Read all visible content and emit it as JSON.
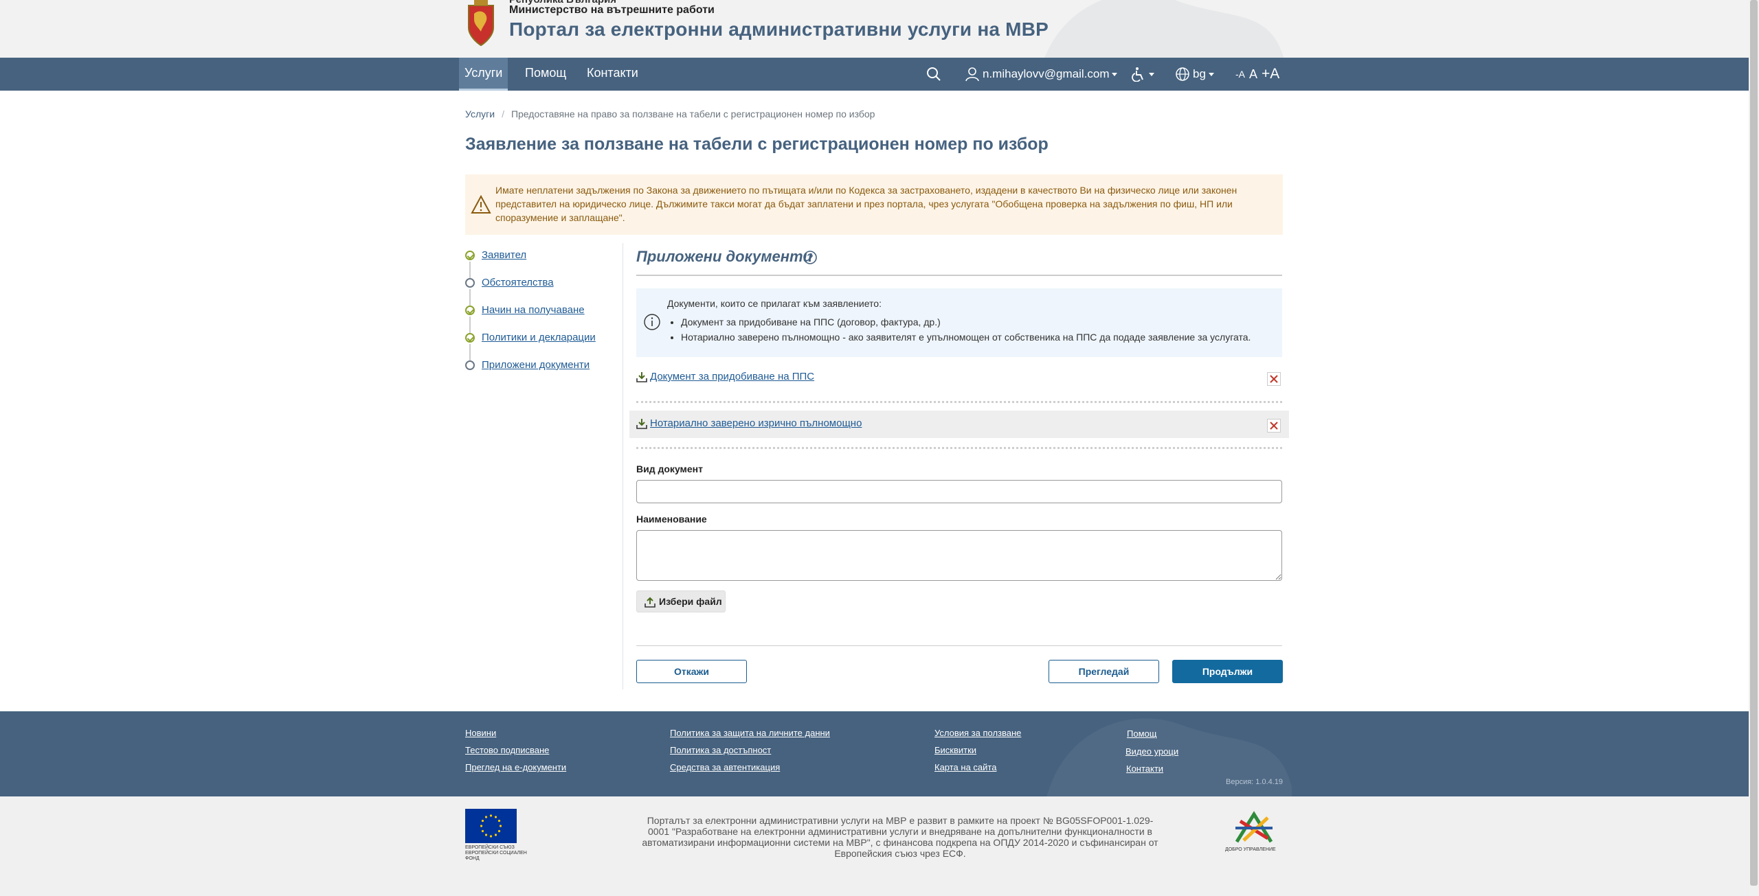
{
  "header": {
    "country": "Република България",
    "ministry": "Министерство на вътрешните работи",
    "portal_title": "Портал за електронни административни услуги на МВР"
  },
  "nav": {
    "items": [
      {
        "label": "Услуги",
        "active": true
      },
      {
        "label": "Помощ"
      },
      {
        "label": "Контакти"
      }
    ],
    "user_email": "n.mihaylovv@gmail.com",
    "language": "bg",
    "font_sizes": [
      "-A",
      "A",
      "+A"
    ]
  },
  "breadcrumb": {
    "home": "Услуги",
    "current": "Предоставяне на право за ползване на табели с регистрационен номер по избор"
  },
  "page_title": "Заявление за ползване на табели с регистрационен номер по избор",
  "alert": {
    "text": "Имате неплатени задължения по Закона за движението по пътищата и/или по Кодекса за застраховането, издадени в качеството Ви на физическо лице или законен представител на юридическо лице. Дължимите такси могат да бъдат заплатени и през портала, чрез услугата \"Обобщена проверка на задължения по фиш, НП или споразумение и заплащане\"."
  },
  "steps": [
    {
      "label": "Заявител",
      "done": true
    },
    {
      "label": "Обстоятелства",
      "done": false
    },
    {
      "label": "Начин на получаване",
      "done": true
    },
    {
      "label": "Политики и декларации",
      "done": true
    },
    {
      "label": "Приложени документи",
      "done": false
    }
  ],
  "section": {
    "title": "Приложени документи"
  },
  "info": {
    "intro": "Документи, които се прилагат към заявлението:",
    "items": [
      "Документ за придобиване на ППС (договор, фактура, др.)",
      "Нотариално заверено пълномощно - ако заявителят е упълномощен от собственика на ППС да подаде заявление за услугата."
    ]
  },
  "documents": [
    {
      "name": "Документ за придобиване на ППС"
    },
    {
      "name": "Нотариално заверено изрично пълномощно"
    }
  ],
  "form": {
    "doc_type_label": "Вид документ",
    "doc_type_value": "",
    "name_label": "Наименование",
    "name_value": "",
    "choose_file": "Избери файл"
  },
  "actions": {
    "cancel": "Откажи",
    "preview": "Прегледай",
    "continue": "Продължи"
  },
  "footer": {
    "col1": [
      "Новини",
      "Тестово подписване",
      "Преглед на е-документи"
    ],
    "col2": [
      "Политика за защита на личните данни",
      "Политика за достъпност",
      "Средства за автентикация"
    ],
    "col3": [
      "Условия за ползване",
      "Бисквитки",
      "Карта на сайта"
    ],
    "col4": [
      "Помощ",
      "Видео уроци",
      "Контакти"
    ],
    "version": "Версия: 1.0.4.19",
    "eu_caption": "ЕВРОПЕЙСКИ СЪЮЗ ЕВРОПЕЙСКИ СОЦИАЛЕН ФОНД",
    "project_text": "Порталът за електронни административни услуги на МВР е развит в рамките на проект № BG05SFOP001-1.029-0001 \"Разработване на електронни административни услуги и внедряване на допълнителни функционалности в автоматизирани информационни системи на МВР\", с финансова подкрепа на ОПДУ 2014-2020 и съфинансиран от Европейския съюз чрез ЕСФ.",
    "gg_caption": "ДОБРО УПРАВЛЕНИЕ"
  },
  "colors": {
    "primary": "#46627f",
    "accent_button": "#136a9f",
    "link": "#1f5b95",
    "alert_bg": "#fdf4e7",
    "info_bg": "#eef5fc",
    "step_done": "#8aa32c"
  },
  "icons": [
    "coat-of-arms-icon",
    "search-icon",
    "user-icon",
    "accessibility-icon",
    "globe-icon",
    "warning-icon",
    "help-icon",
    "info-icon",
    "download-icon",
    "close-icon",
    "upload-icon"
  ]
}
